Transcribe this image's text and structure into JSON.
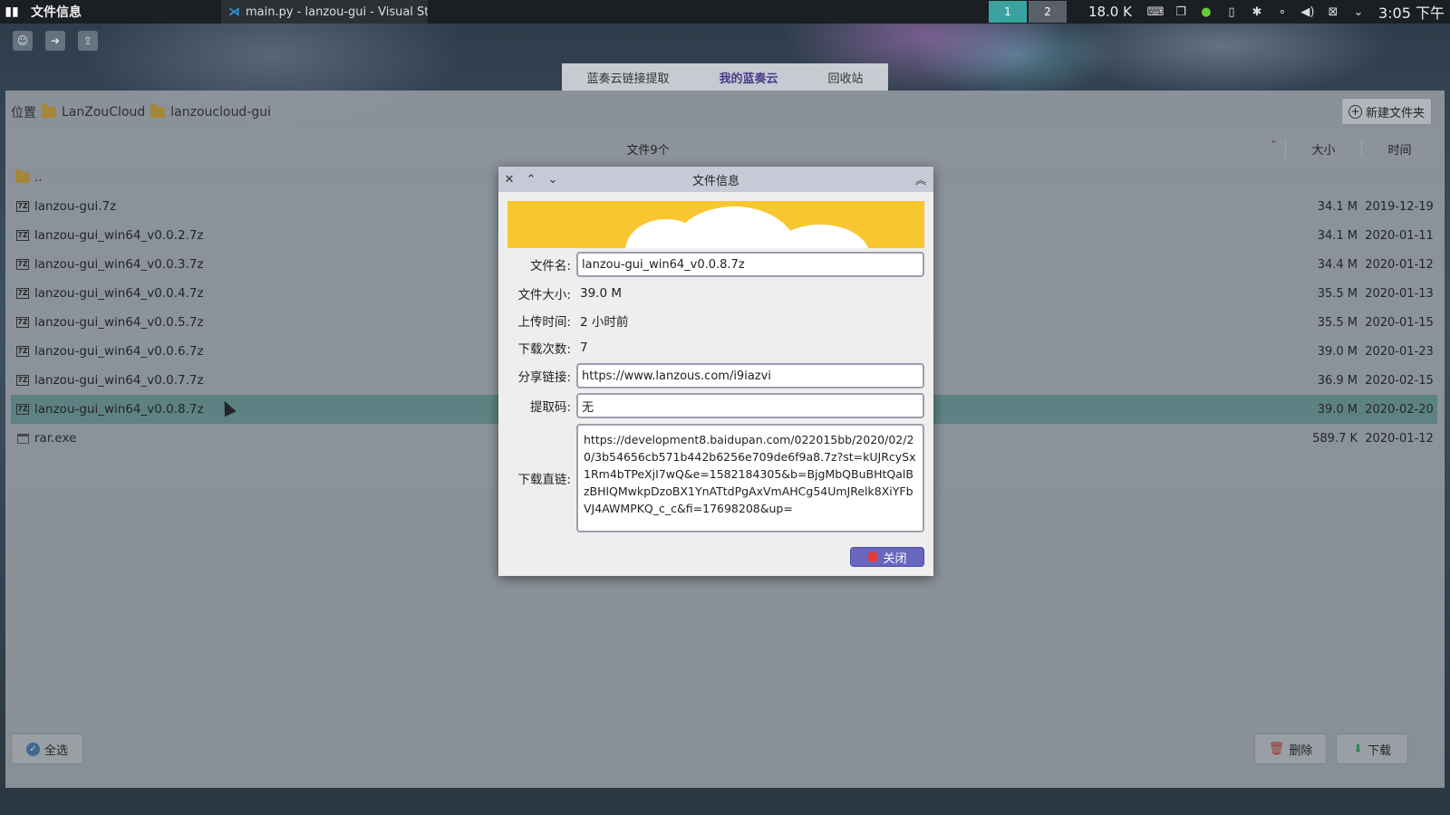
{
  "topbar": {
    "active_title": "文件信息",
    "task_title": "main.py - lanzou-gui - Visual St···",
    "workspace_1": "1",
    "workspace_2": "2",
    "net_speed": "18.0 K",
    "clock": "3:05 下午"
  },
  "tabs": [
    {
      "label": "蓝奏云链接提取"
    },
    {
      "label": "我的蓝奏云"
    },
    {
      "label": "回收站"
    }
  ],
  "breadcrumb": {
    "prefix": "位置",
    "items": [
      "LanZouCloud",
      "lanzoucloud-gui"
    ]
  },
  "new_folder_label": "新建文件夹",
  "table": {
    "header_name": "文件9个",
    "header_size": "大小",
    "header_time": "时间",
    "parent_dir": "..",
    "rows": [
      {
        "name": "lanzou-gui.7z",
        "size": "34.1 M",
        "time": "2019-12-19",
        "icon": "7z"
      },
      {
        "name": "lanzou-gui_win64_v0.0.2.7z",
        "size": "34.1 M",
        "time": "2020-01-11",
        "icon": "7z"
      },
      {
        "name": "lanzou-gui_win64_v0.0.3.7z",
        "size": "34.4 M",
        "time": "2020-01-12",
        "icon": "7z"
      },
      {
        "name": "lanzou-gui_win64_v0.0.4.7z",
        "size": "35.5 M",
        "time": "2020-01-13",
        "icon": "7z"
      },
      {
        "name": "lanzou-gui_win64_v0.0.5.7z",
        "size": "35.5 M",
        "time": "2020-01-15",
        "icon": "7z"
      },
      {
        "name": "lanzou-gui_win64_v0.0.6.7z",
        "size": "39.0 M",
        "time": "2020-01-23",
        "icon": "7z"
      },
      {
        "name": "lanzou-gui_win64_v0.0.7.7z",
        "size": "36.9 M",
        "time": "2020-02-15",
        "icon": "7z"
      },
      {
        "name": "lanzou-gui_win64_v0.0.8.7z",
        "size": "39.0 M",
        "time": "2020-02-20",
        "icon": "7z"
      },
      {
        "name": "rar.exe",
        "size": "589.7 K",
        "time": "2020-01-12",
        "icon": "exe"
      }
    ]
  },
  "bottom": {
    "select_all": "全选",
    "delete": "删除",
    "download": "下载"
  },
  "dialog": {
    "title": "文件信息",
    "labels": {
      "filename": "文件名:",
      "size": "文件大小:",
      "upload_time": "上传时间:",
      "downloads": "下载次数:",
      "share_link": "分享链接:",
      "code": "提取码:",
      "direct_link": "下载直链:"
    },
    "values": {
      "filename": "lanzou-gui_win64_v0.0.8.7z",
      "size": "39.0 M",
      "upload_time": "2 小时前",
      "downloads": "7",
      "share_link": "https://www.lanzous.com/i9iazvi",
      "code": "无",
      "direct_link": "https://development8.baidupan.com/022015bb/2020/02/20/3b54656cb571b442b6256e709de6f9a8.7z?st=kUJRcySx1Rm4bTPeXjI7wQ&e=1582184305&b=BjgMbQBuBHtQalBzBHlQMwkpDzoBX1YnATtdPgAxVmAHCg54UmJRelk8XiYFbVJ4AWMPKQ_c_c&fi=17698208&up="
    },
    "close_label": "关闭"
  },
  "colors": {
    "selected_row": "#5f9b96",
    "banner": "#f8c630",
    "close_button": "#6767c0"
  }
}
